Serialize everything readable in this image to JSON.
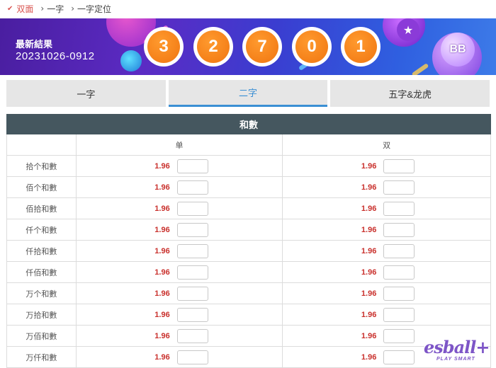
{
  "breadcrumb": {
    "items": [
      "双面",
      "一字",
      "一字定位"
    ]
  },
  "result": {
    "label": "最新結果",
    "period": "20231026-0912",
    "numbers": [
      "3",
      "2",
      "7",
      "0",
      "1"
    ],
    "badge": "BB"
  },
  "tabs": [
    {
      "label": "一字",
      "active": false
    },
    {
      "label": "二字",
      "active": true
    },
    {
      "label": "五字&龙虎",
      "active": false
    }
  ],
  "table": {
    "group_header": "和數",
    "col_headers": [
      "单",
      "双"
    ],
    "rows": [
      {
        "name": "拾个和數",
        "odd_a": "1.96",
        "odd_b": "1.96"
      },
      {
        "name": "佰个和數",
        "odd_a": "1.96",
        "odd_b": "1.96"
      },
      {
        "name": "佰拾和數",
        "odd_a": "1.96",
        "odd_b": "1.96"
      },
      {
        "name": "仟个和數",
        "odd_a": "1.96",
        "odd_b": "1.96"
      },
      {
        "name": "仟拾和數",
        "odd_a": "1.96",
        "odd_b": "1.96"
      },
      {
        "name": "仟佰和數",
        "odd_a": "1.96",
        "odd_b": "1.96"
      },
      {
        "name": "万个和數",
        "odd_a": "1.96",
        "odd_b": "1.96"
      },
      {
        "name": "万拾和數",
        "odd_a": "1.96",
        "odd_b": "1.96"
      },
      {
        "name": "万佰和數",
        "odd_a": "1.96",
        "odd_b": "1.96"
      },
      {
        "name": "万仟和數",
        "odd_a": "1.96",
        "odd_b": "1.96"
      }
    ]
  },
  "watermark": {
    "brand": "esball+",
    "tagline": "PLAY SMART"
  },
  "colors": {
    "accent": "#3a8fd4",
    "odd_value": "#c9302c",
    "header_bg": "#45575f",
    "ball": "#f07510"
  }
}
